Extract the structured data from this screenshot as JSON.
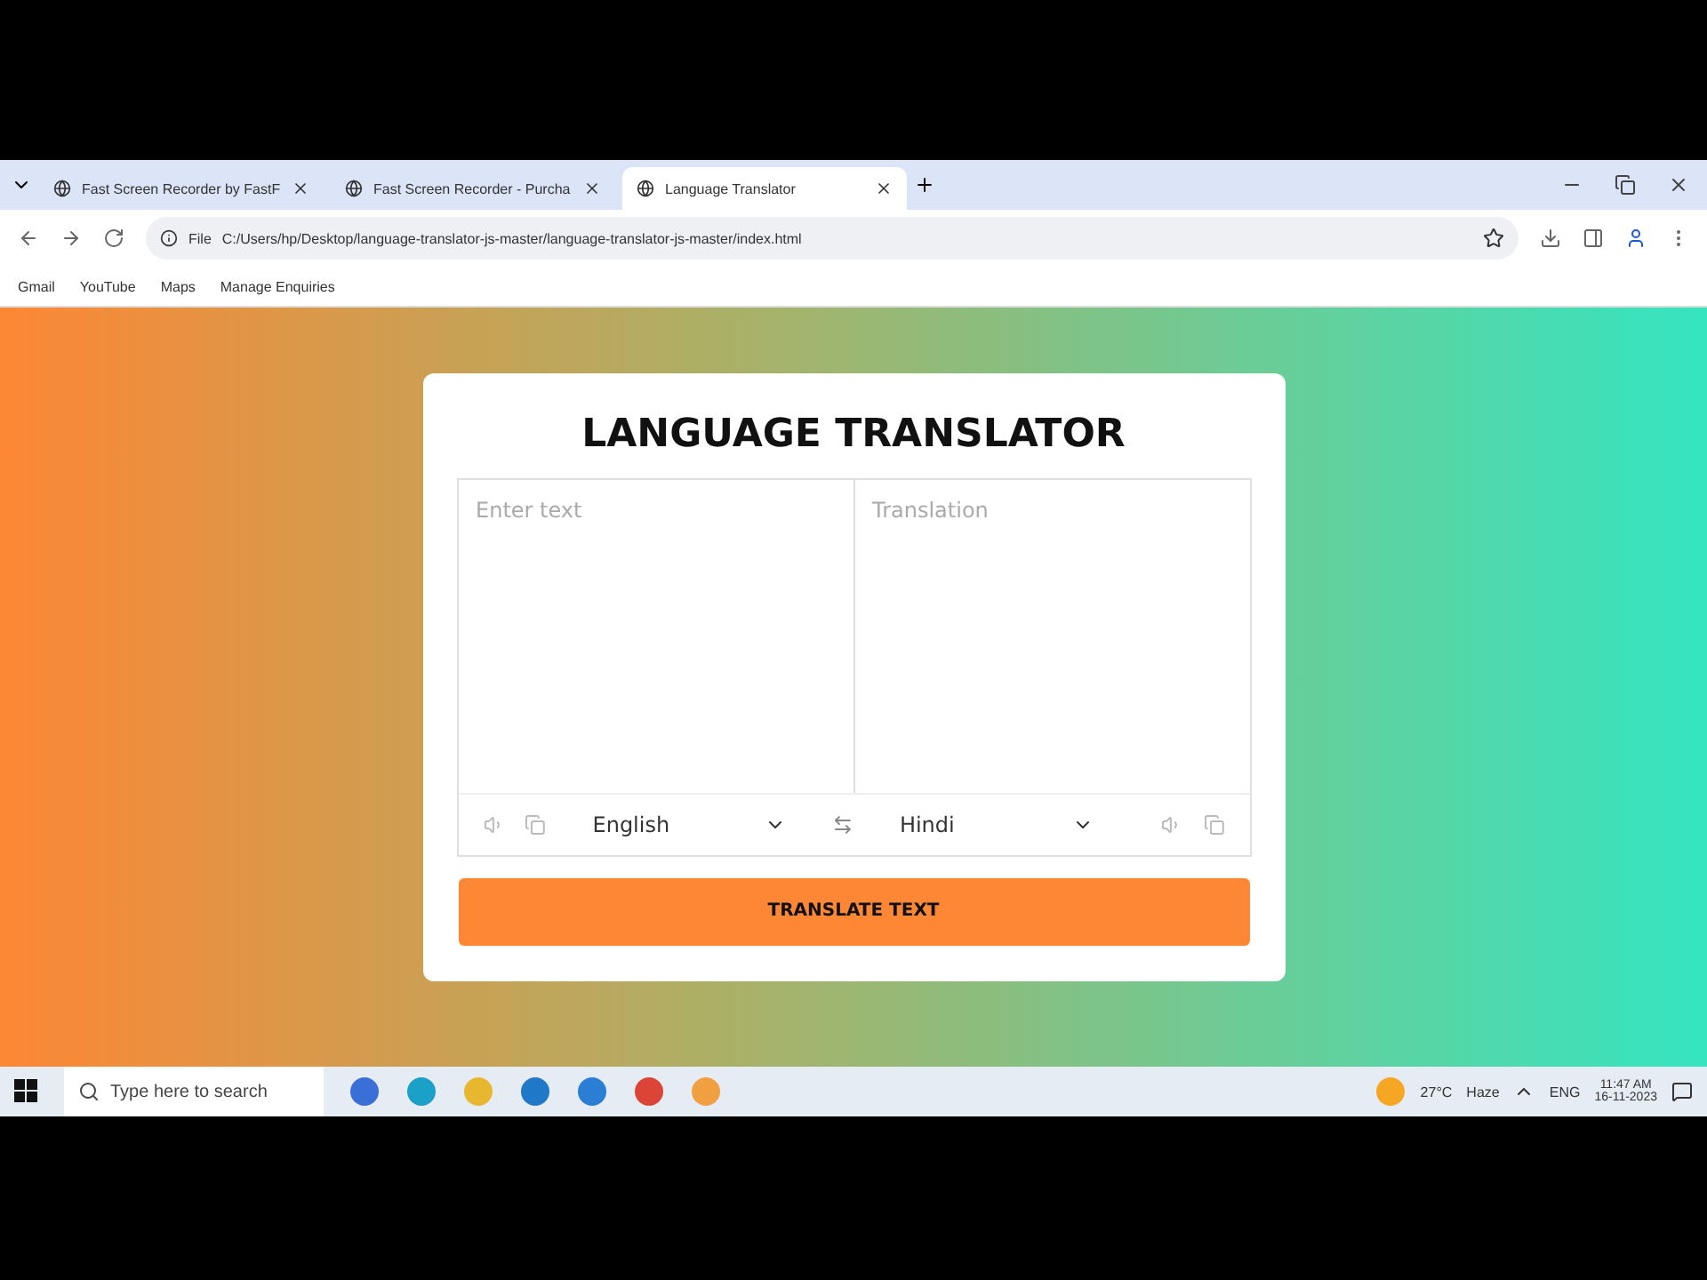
{
  "tabs": [
    {
      "title": "Fast Screen Recorder by FastF",
      "selected": false
    },
    {
      "title": "Fast Screen Recorder - Purcha",
      "selected": false
    },
    {
      "title": "Language Translator",
      "selected": true
    }
  ],
  "address": {
    "scheme": "File",
    "url": "C:/Users/hp/Desktop/language-translator-js-master/language-translator-js-master/index.html"
  },
  "bookmarks": [
    "Gmail",
    "YouTube",
    "Maps",
    "Manage Enquiries"
  ],
  "card": {
    "title": "LANGUAGE TRANSLATOR",
    "source": {
      "placeholder": "Enter text",
      "language": "English"
    },
    "target": {
      "placeholder": "Translation",
      "language": "Hindi"
    },
    "button": "TRANSLATE TEXT"
  },
  "taskbar": {
    "search_placeholder": "Type here to search",
    "weather": "27°C",
    "condition": "Haze",
    "language": "ENG",
    "time": "11:47 AM",
    "date": "16-11-2023"
  }
}
